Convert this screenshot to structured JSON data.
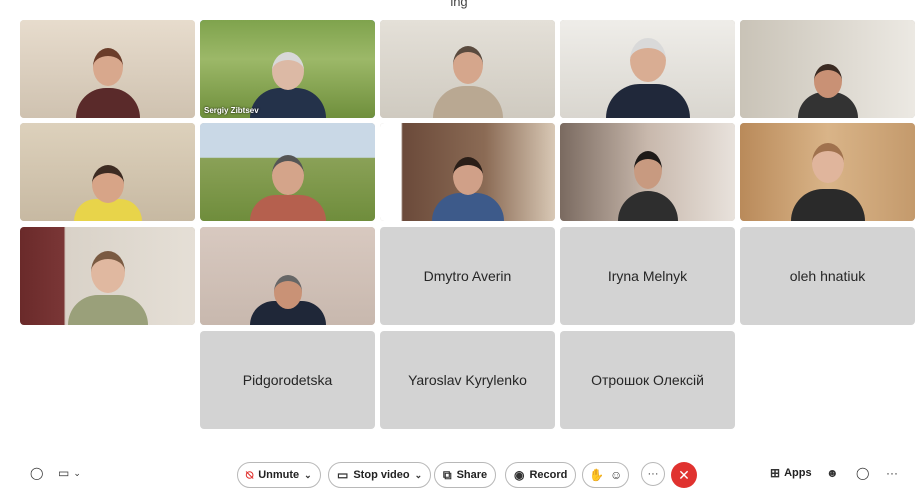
{
  "window": {
    "title": "ing"
  },
  "participants": [
    {
      "name": "",
      "video": true
    },
    {
      "name": "Sergiy Zibtsev",
      "video": true,
      "active_speaker": true
    },
    {
      "name": "",
      "video": true
    },
    {
      "name": "",
      "video": true
    },
    {
      "name": "",
      "video": true
    },
    {
      "name": "",
      "video": true
    },
    {
      "name": "",
      "video": true
    },
    {
      "name": "",
      "video": true
    },
    {
      "name": "",
      "video": true
    },
    {
      "name": "",
      "video": true
    },
    {
      "name": "",
      "video": true
    },
    {
      "name": "",
      "video": true
    },
    {
      "name": "Dmytro Averin",
      "video": false
    },
    {
      "name": "Iryna Melnyk",
      "video": false
    },
    {
      "name": "oleh hnatiuk",
      "video": false
    },
    {
      "name": "Pidgorodetska",
      "video": false
    },
    {
      "name": "Yaroslav Kyrylenko",
      "video": false
    },
    {
      "name": "Отрошок Олексій",
      "video": false
    }
  ],
  "toolbar": {
    "unmute_label": "Unmute",
    "stop_video_label": "Stop video",
    "share_label": "Share",
    "record_label": "Record",
    "apps_label": "Apps",
    "more_label": "···",
    "leave_label": "✕"
  },
  "colors": {
    "active_outline": "#4aa3df",
    "danger": "#e0322f",
    "tile_bg": "#d3d3d3"
  },
  "icons": {
    "layout": "circle-icon",
    "captions": "captions-icon",
    "mute": "mic-muted-icon",
    "video": "video-camera-icon",
    "share": "share-screen-icon",
    "record": "record-icon",
    "hand": "raise-hand-icon",
    "reactions": "emoji-icon",
    "apps": "apps-icon",
    "participants": "participants-icon",
    "chat": "chat-icon"
  }
}
